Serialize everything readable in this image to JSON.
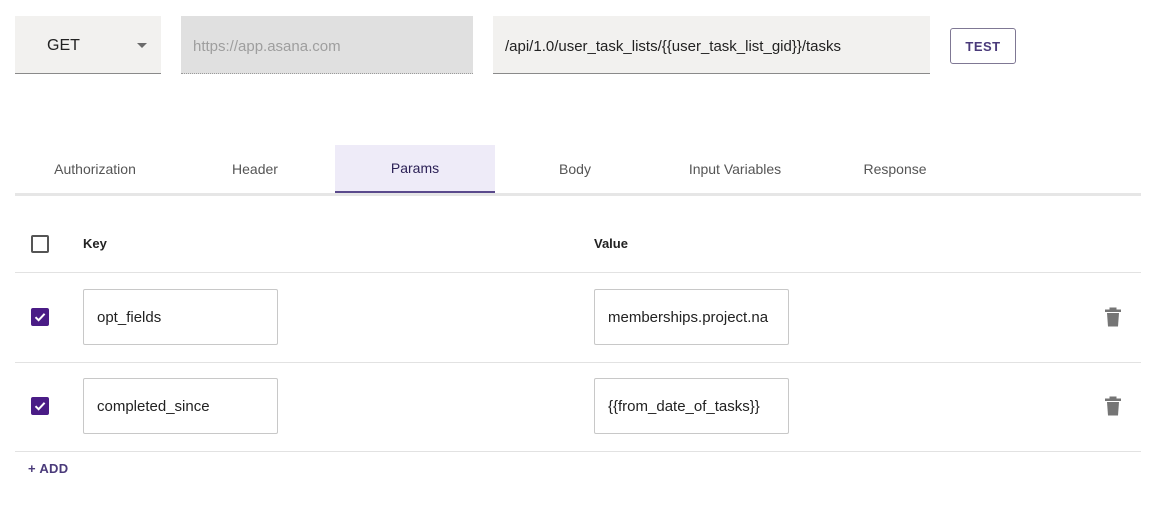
{
  "request": {
    "method": "GET",
    "base_url_placeholder": "https://app.asana.com",
    "path": "/api/1.0/user_task_lists/{{user_task_list_gid}}/tasks",
    "test_label": "TEST"
  },
  "tabs": [
    {
      "label": "Authorization",
      "active": false
    },
    {
      "label": "Header",
      "active": false
    },
    {
      "label": "Params",
      "active": true
    },
    {
      "label": "Body",
      "active": false
    },
    {
      "label": "Input Variables",
      "active": false
    },
    {
      "label": "Response",
      "active": false
    }
  ],
  "params_table": {
    "headers": {
      "key": "Key",
      "value": "Value"
    },
    "select_all_checked": false,
    "rows": [
      {
        "checked": true,
        "key": "opt_fields",
        "value": "memberships.project.na"
      },
      {
        "checked": true,
        "key": "completed_since",
        "value": "{{from_date_of_tasks}}"
      }
    ],
    "add_label": "+ ADD"
  },
  "colors": {
    "accent": "#4a1c86",
    "active_tab_bg": "#eeebf8",
    "button_text": "#4a3a7a"
  },
  "icons": {
    "method_dropdown": "caret-down-icon",
    "row_delete": "trash-icon",
    "row_check": "checkbox-checked-icon"
  }
}
